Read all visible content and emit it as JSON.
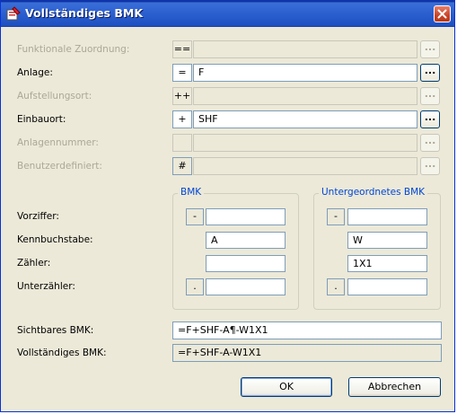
{
  "window": {
    "title": "Vollständiges BMK"
  },
  "rows": [
    {
      "label": "Funktionale Zuordnung:",
      "prefix": "==",
      "value": "",
      "enabled": false
    },
    {
      "label": "Anlage:",
      "prefix": "=",
      "value": "F",
      "enabled": true
    },
    {
      "label": "Aufstellungsort:",
      "prefix": "++",
      "value": "",
      "enabled": false
    },
    {
      "label": "Einbauort:",
      "prefix": "+",
      "value": "SHF",
      "enabled": true
    },
    {
      "label": "Anlagennummer:",
      "prefix": "",
      "value": "",
      "enabled": false
    },
    {
      "label": "Benutzerdefiniert:",
      "prefix": "#",
      "value": "",
      "enabled": false
    }
  ],
  "browse_label": "...",
  "groups": {
    "bmk": {
      "title": "BMK"
    },
    "sub": {
      "title": "Untergeordnetes BMK"
    }
  },
  "fields": {
    "vorziffer": {
      "label": "Vorziffer:",
      "prefix": "-",
      "bmk": "",
      "sub_prefix": "-",
      "sub": ""
    },
    "kennbuchstabe": {
      "label": "Kennbuchstabe:",
      "bmk": "A",
      "sub": "W"
    },
    "zaehler": {
      "label": "Zähler:",
      "bmk": "",
      "sub": "1X1"
    },
    "unterzaehler": {
      "label": "Unterzähler:",
      "prefix": ".",
      "bmk": "",
      "sub_prefix": ".",
      "sub": ""
    }
  },
  "sichtbares": {
    "label": "Sichtbares BMK:",
    "value": "=F+SHF-A¶-W1X1"
  },
  "vollstaendiges": {
    "label": "Vollständiges BMK:",
    "value": "=F+SHF-A-W1X1"
  },
  "buttons": {
    "ok": "OK",
    "cancel": "Abbrechen"
  },
  "colors": {
    "titlebar": "#2c5fcf",
    "group_title": "#0046d5",
    "dialog_bg": "#ece9d8",
    "disabled_text": "#aca899"
  }
}
